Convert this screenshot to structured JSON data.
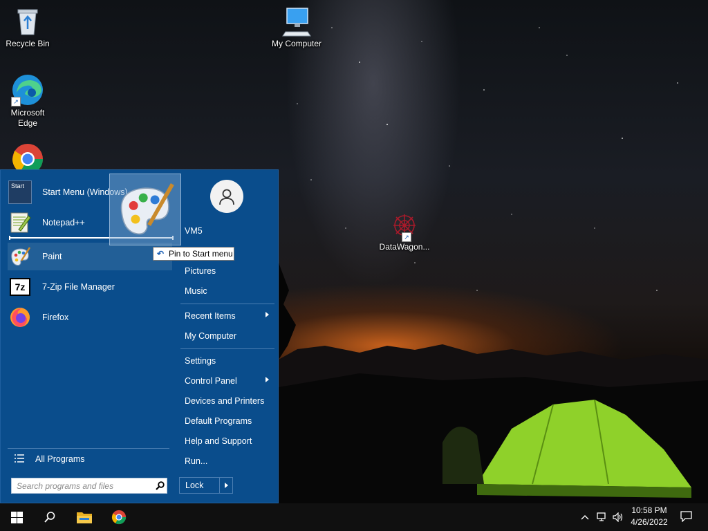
{
  "desktop": {
    "icons": [
      {
        "label": "Recycle Bin",
        "icon": "recycle-bin-icon"
      },
      {
        "label": "My Computer",
        "icon": "computer-icon"
      },
      {
        "label": "Microsoft Edge",
        "icon": "edge-icon"
      },
      {
        "label": "DataWagon...",
        "icon": "datawagon-icon"
      },
      {
        "label": "",
        "icon": "chrome-icon"
      }
    ]
  },
  "start_menu": {
    "apps": [
      {
        "label": "Start Menu (Windows)",
        "icon": "start-menu-app-icon"
      },
      {
        "label": "Notepad++",
        "icon": "notepad-plus-plus-icon"
      },
      {
        "label": "Paint",
        "icon": "paint-icon"
      },
      {
        "label": "7-Zip File Manager",
        "icon": "seven-zip-icon"
      },
      {
        "label": "Firefox",
        "icon": "firefox-icon"
      }
    ],
    "all_programs": "All Programs",
    "search": {
      "placeholder": "Search programs and files",
      "value": ""
    },
    "user": {
      "name": "VM5"
    },
    "right_items": [
      "Pictures",
      "Music",
      "Recent Items",
      "My Computer",
      "Settings",
      "Control Panel",
      "Devices and Printers",
      "Default Programs",
      "Help and Support",
      "Run..."
    ],
    "lock": {
      "label": "Lock"
    },
    "start_tile_text": "Start"
  },
  "drag": {
    "tooltip": "Pin to Start menu"
  },
  "taskbar": {
    "time": "10:58 PM",
    "date": "4/26/2022"
  },
  "colors": {
    "menu_bg": "#0a4d8c",
    "taskbar_bg": "#101010",
    "accent": "#1a5fb4"
  }
}
